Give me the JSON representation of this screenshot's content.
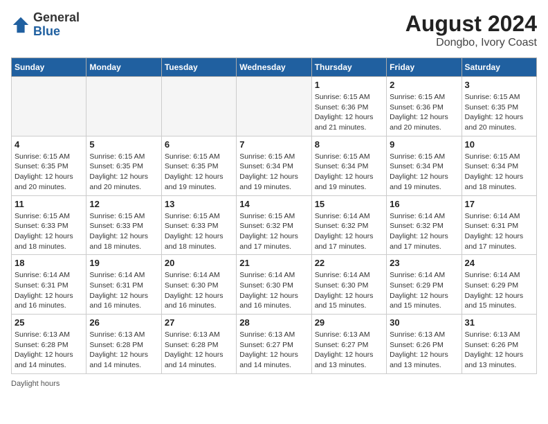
{
  "header": {
    "logo_general": "General",
    "logo_blue": "Blue",
    "title": "August 2024",
    "subtitle": "Dongbo, Ivory Coast"
  },
  "days_of_week": [
    "Sunday",
    "Monday",
    "Tuesday",
    "Wednesday",
    "Thursday",
    "Friday",
    "Saturday"
  ],
  "weeks": [
    [
      {
        "day": "",
        "detail": ""
      },
      {
        "day": "",
        "detail": ""
      },
      {
        "day": "",
        "detail": ""
      },
      {
        "day": "",
        "detail": ""
      },
      {
        "day": "1",
        "detail": "Sunrise: 6:15 AM\nSunset: 6:36 PM\nDaylight: 12 hours and 21 minutes."
      },
      {
        "day": "2",
        "detail": "Sunrise: 6:15 AM\nSunset: 6:36 PM\nDaylight: 12 hours and 20 minutes."
      },
      {
        "day": "3",
        "detail": "Sunrise: 6:15 AM\nSunset: 6:35 PM\nDaylight: 12 hours and 20 minutes."
      }
    ],
    [
      {
        "day": "4",
        "detail": "Sunrise: 6:15 AM\nSunset: 6:35 PM\nDaylight: 12 hours and 20 minutes."
      },
      {
        "day": "5",
        "detail": "Sunrise: 6:15 AM\nSunset: 6:35 PM\nDaylight: 12 hours and 20 minutes."
      },
      {
        "day": "6",
        "detail": "Sunrise: 6:15 AM\nSunset: 6:35 PM\nDaylight: 12 hours and 19 minutes."
      },
      {
        "day": "7",
        "detail": "Sunrise: 6:15 AM\nSunset: 6:34 PM\nDaylight: 12 hours and 19 minutes."
      },
      {
        "day": "8",
        "detail": "Sunrise: 6:15 AM\nSunset: 6:34 PM\nDaylight: 12 hours and 19 minutes."
      },
      {
        "day": "9",
        "detail": "Sunrise: 6:15 AM\nSunset: 6:34 PM\nDaylight: 12 hours and 19 minutes."
      },
      {
        "day": "10",
        "detail": "Sunrise: 6:15 AM\nSunset: 6:34 PM\nDaylight: 12 hours and 18 minutes."
      }
    ],
    [
      {
        "day": "11",
        "detail": "Sunrise: 6:15 AM\nSunset: 6:33 PM\nDaylight: 12 hours and 18 minutes."
      },
      {
        "day": "12",
        "detail": "Sunrise: 6:15 AM\nSunset: 6:33 PM\nDaylight: 12 hours and 18 minutes."
      },
      {
        "day": "13",
        "detail": "Sunrise: 6:15 AM\nSunset: 6:33 PM\nDaylight: 12 hours and 18 minutes."
      },
      {
        "day": "14",
        "detail": "Sunrise: 6:15 AM\nSunset: 6:32 PM\nDaylight: 12 hours and 17 minutes."
      },
      {
        "day": "15",
        "detail": "Sunrise: 6:14 AM\nSunset: 6:32 PM\nDaylight: 12 hours and 17 minutes."
      },
      {
        "day": "16",
        "detail": "Sunrise: 6:14 AM\nSunset: 6:32 PM\nDaylight: 12 hours and 17 minutes."
      },
      {
        "day": "17",
        "detail": "Sunrise: 6:14 AM\nSunset: 6:31 PM\nDaylight: 12 hours and 17 minutes."
      }
    ],
    [
      {
        "day": "18",
        "detail": "Sunrise: 6:14 AM\nSunset: 6:31 PM\nDaylight: 12 hours and 16 minutes."
      },
      {
        "day": "19",
        "detail": "Sunrise: 6:14 AM\nSunset: 6:31 PM\nDaylight: 12 hours and 16 minutes."
      },
      {
        "day": "20",
        "detail": "Sunrise: 6:14 AM\nSunset: 6:30 PM\nDaylight: 12 hours and 16 minutes."
      },
      {
        "day": "21",
        "detail": "Sunrise: 6:14 AM\nSunset: 6:30 PM\nDaylight: 12 hours and 16 minutes."
      },
      {
        "day": "22",
        "detail": "Sunrise: 6:14 AM\nSunset: 6:30 PM\nDaylight: 12 hours and 15 minutes."
      },
      {
        "day": "23",
        "detail": "Sunrise: 6:14 AM\nSunset: 6:29 PM\nDaylight: 12 hours and 15 minutes."
      },
      {
        "day": "24",
        "detail": "Sunrise: 6:14 AM\nSunset: 6:29 PM\nDaylight: 12 hours and 15 minutes."
      }
    ],
    [
      {
        "day": "25",
        "detail": "Sunrise: 6:13 AM\nSunset: 6:28 PM\nDaylight: 12 hours and 14 minutes."
      },
      {
        "day": "26",
        "detail": "Sunrise: 6:13 AM\nSunset: 6:28 PM\nDaylight: 12 hours and 14 minutes."
      },
      {
        "day": "27",
        "detail": "Sunrise: 6:13 AM\nSunset: 6:28 PM\nDaylight: 12 hours and 14 minutes."
      },
      {
        "day": "28",
        "detail": "Sunrise: 6:13 AM\nSunset: 6:27 PM\nDaylight: 12 hours and 14 minutes."
      },
      {
        "day": "29",
        "detail": "Sunrise: 6:13 AM\nSunset: 6:27 PM\nDaylight: 12 hours and 13 minutes."
      },
      {
        "day": "30",
        "detail": "Sunrise: 6:13 AM\nSunset: 6:26 PM\nDaylight: 12 hours and 13 minutes."
      },
      {
        "day": "31",
        "detail": "Sunrise: 6:13 AM\nSunset: 6:26 PM\nDaylight: 12 hours and 13 minutes."
      }
    ]
  ],
  "footnote": "Daylight hours"
}
